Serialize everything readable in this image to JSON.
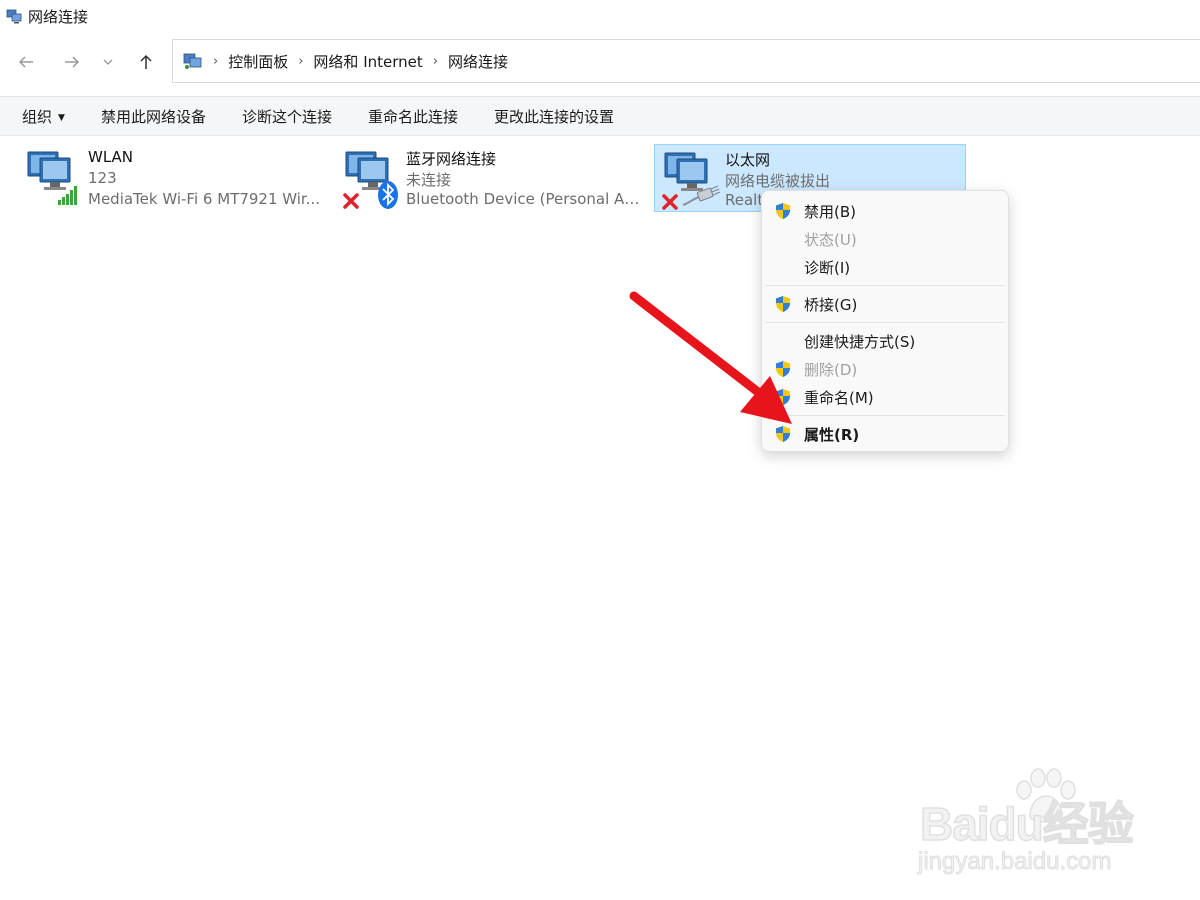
{
  "window": {
    "title": "网络连接",
    "icon": "network-connections-icon"
  },
  "nav": {
    "back_icon": "back-arrow-icon",
    "forward_icon": "forward-arrow-icon",
    "recent_icon": "chevron-down-icon",
    "up_icon": "up-arrow-icon",
    "breadcrumb": [
      "控制面板",
      "网络和 Internet",
      "网络连接"
    ]
  },
  "toolbar": {
    "organize": "组织",
    "disable": "禁用此网络设备",
    "diagnose": "诊断这个连接",
    "rename": "重命名此连接",
    "change_settings": "更改此连接的设置"
  },
  "adapters": [
    {
      "name": "WLAN",
      "status": "123",
      "device": "MediaTek Wi-Fi 6 MT7921 Wir...",
      "overlay_icon": "wifi-signal-icon"
    },
    {
      "name": "蓝牙网络连接",
      "status": "未连接",
      "device": "Bluetooth Device (Personal Ar...",
      "overlay_icon": "bluetooth-icon"
    },
    {
      "name": "以太网",
      "status": "网络电缆被拔出",
      "device": "Realtek PCIe GbE Family Controller",
      "overlay_icon": "ethernet-cable-icon",
      "selected": true
    }
  ],
  "context_menu": {
    "items": [
      {
        "label": "禁用(B)",
        "shield": true,
        "disabled": false
      },
      {
        "label": "状态(U)",
        "shield": false,
        "disabled": true
      },
      {
        "label": "诊断(I)",
        "shield": false,
        "disabled": false
      },
      {
        "label": "桥接(G)",
        "shield": true,
        "disabled": false
      },
      {
        "label": "创建快捷方式(S)",
        "shield": false,
        "disabled": false
      },
      {
        "label": "删除(D)",
        "shield": true,
        "disabled": true
      },
      {
        "label": "重命名(M)",
        "shield": true,
        "disabled": false
      },
      {
        "label": "属性(R)",
        "shield": true,
        "disabled": false,
        "bold": true
      }
    ]
  },
  "annotation": {
    "arrow_color": "#e8141b"
  },
  "watermark": {
    "brand": "Baidu经验",
    "url": "jingyan.baidu.com"
  },
  "colors": {
    "selection_bg": "#cce8ff",
    "selection_border": "#99d1ff",
    "toolbar_bg": "#f5f6f7",
    "error_red": "#e0232a",
    "signal_green": "#3da53d"
  }
}
